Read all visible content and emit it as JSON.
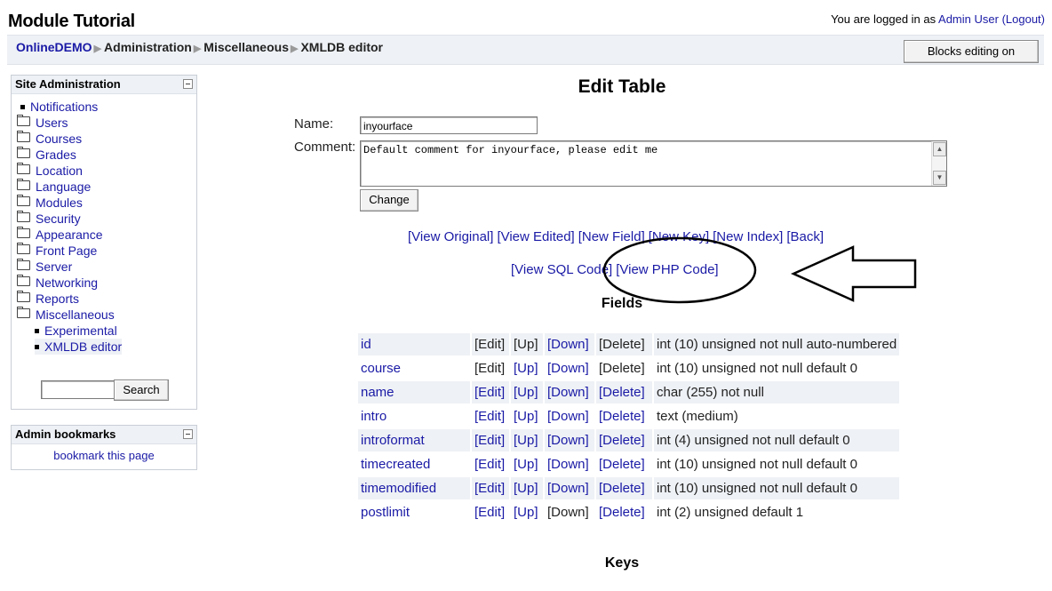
{
  "header": {
    "site_title": "Module Tutorial",
    "login_prefix": "You are logged in as ",
    "user_name": "Admin User",
    "logout_label": "(Logout)",
    "blocks_editing_label": "Blocks editing on"
  },
  "breadcrumb": [
    "OnlineDEMO",
    "Administration",
    "Miscellaneous",
    "XMLDB editor"
  ],
  "breadcrumb_separator": "▶",
  "site_admin": {
    "title": "Site Administration",
    "items": [
      {
        "label": "Notifications",
        "icon": "bullet"
      },
      {
        "label": "Users",
        "icon": "folder"
      },
      {
        "label": "Courses",
        "icon": "folder"
      },
      {
        "label": "Grades",
        "icon": "folder"
      },
      {
        "label": "Location",
        "icon": "folder"
      },
      {
        "label": "Language",
        "icon": "folder"
      },
      {
        "label": "Modules",
        "icon": "folder"
      },
      {
        "label": "Security",
        "icon": "folder"
      },
      {
        "label": "Appearance",
        "icon": "folder"
      },
      {
        "label": "Front Page",
        "icon": "folder"
      },
      {
        "label": "Server",
        "icon": "folder"
      },
      {
        "label": "Networking",
        "icon": "folder"
      },
      {
        "label": "Reports",
        "icon": "folder"
      },
      {
        "label": "Miscellaneous",
        "icon": "folder-open"
      },
      {
        "label": "Experimental",
        "icon": "bullet"
      },
      {
        "label": "XMLDB editor",
        "icon": "bullet"
      }
    ],
    "search_button": "Search",
    "search_value": ""
  },
  "admin_bookmarks": {
    "title": "Admin bookmarks",
    "link": "bookmark this page"
  },
  "main": {
    "heading": "Edit Table",
    "name_label": "Name:",
    "name_value": "inyourface",
    "comment_label": "Comment:",
    "comment_value": "Default comment for inyourface, please edit me",
    "change_button": "Change",
    "links_row1": [
      "[View Original]",
      "[View Edited]",
      "[New Field]",
      "[New Key]",
      "[New Index]",
      "[Back]"
    ],
    "links_row2": [
      "[View SQL Code]",
      "[View PHP Code]"
    ],
    "fields_heading": "Fields",
    "keys_heading": "Keys",
    "fields": [
      {
        "name": "id",
        "edit": "[Edit]",
        "up": "[Up]",
        "down": "[Down]",
        "delete": "[Delete]",
        "desc": "int (10) unsigned not null auto-numbered",
        "up_link": false,
        "down_link": true,
        "edit_link": false,
        "delete_link": false
      },
      {
        "name": "course",
        "edit": "[Edit]",
        "up": "[Up]",
        "down": "[Down]",
        "delete": "[Delete]",
        "desc": "int (10) unsigned not null default 0",
        "up_link": true,
        "down_link": true,
        "edit_link": false,
        "delete_link": false
      },
      {
        "name": "name",
        "edit": "[Edit]",
        "up": "[Up]",
        "down": "[Down]",
        "delete": "[Delete]",
        "desc": "char (255) not null",
        "up_link": true,
        "down_link": true,
        "edit_link": true,
        "delete_link": true
      },
      {
        "name": "intro",
        "edit": "[Edit]",
        "up": "[Up]",
        "down": "[Down]",
        "delete": "[Delete]",
        "desc": "text (medium)",
        "up_link": true,
        "down_link": true,
        "edit_link": true,
        "delete_link": true
      },
      {
        "name": "introformat",
        "edit": "[Edit]",
        "up": "[Up]",
        "down": "[Down]",
        "delete": "[Delete]",
        "desc": "int (4) unsigned not null default 0",
        "up_link": true,
        "down_link": true,
        "edit_link": true,
        "delete_link": true
      },
      {
        "name": "timecreated",
        "edit": "[Edit]",
        "up": "[Up]",
        "down": "[Down]",
        "delete": "[Delete]",
        "desc": "int (10) unsigned not null default 0",
        "up_link": true,
        "down_link": true,
        "edit_link": true,
        "delete_link": true
      },
      {
        "name": "timemodified",
        "edit": "[Edit]",
        "up": "[Up]",
        "down": "[Down]",
        "delete": "[Delete]",
        "desc": "int (10) unsigned not null default 0",
        "up_link": true,
        "down_link": true,
        "edit_link": true,
        "delete_link": true
      },
      {
        "name": "postlimit",
        "edit": "[Edit]",
        "up": "[Up]",
        "down": "[Down]",
        "delete": "[Delete]",
        "desc": "int (2) unsigned default 1",
        "up_link": true,
        "down_link": false,
        "edit_link": true,
        "delete_link": true
      }
    ]
  },
  "colors": {
    "link": "#1a1aa6",
    "block_header": "#eef1f5",
    "row_alt": "#eef1f5"
  }
}
